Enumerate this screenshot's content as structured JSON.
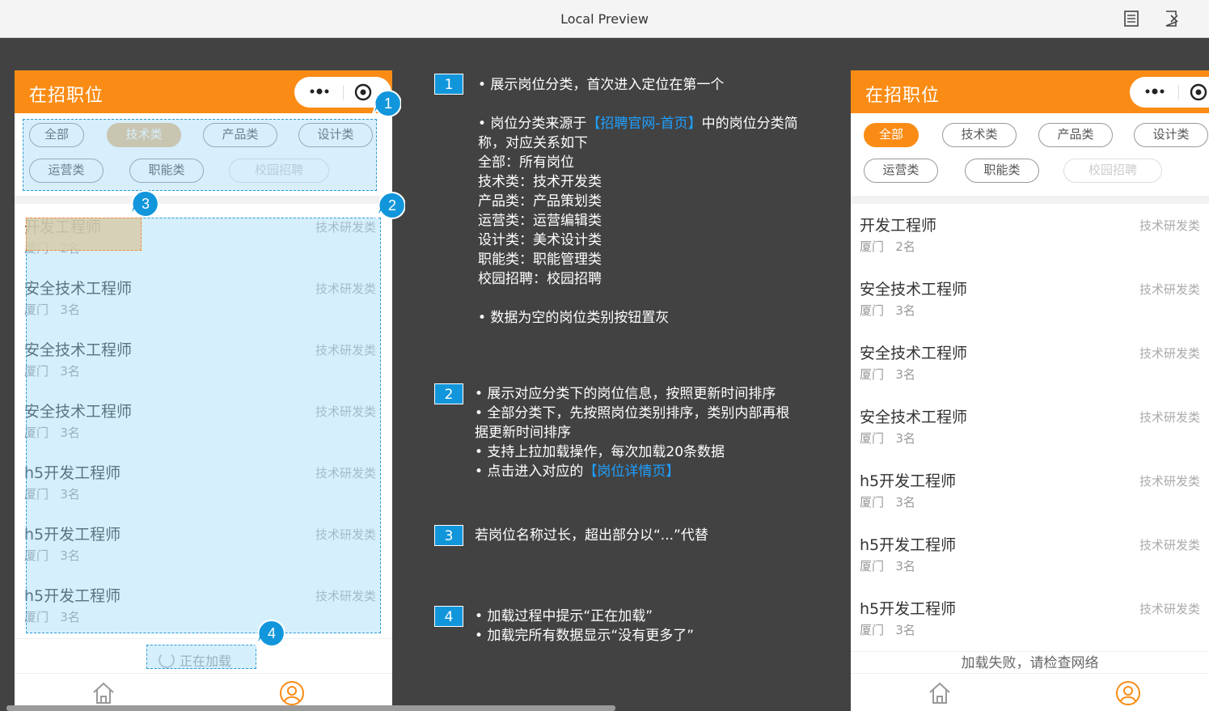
{
  "window": {
    "title": "Local Preview"
  },
  "phone": {
    "title": "在招职位",
    "tabs": [
      {
        "label": "全部",
        "state": "normal"
      },
      {
        "label": "技术类",
        "state": "active"
      },
      {
        "label": "产品类",
        "state": "normal"
      },
      {
        "label": "设计类",
        "state": "normal"
      },
      {
        "label": "运营类",
        "state": "normal"
      },
      {
        "label": "职能类",
        "state": "normal"
      },
      {
        "label": "校园招聘",
        "state": "disabled"
      }
    ],
    "jobs": [
      {
        "name": "开发工程师",
        "city": "厦门",
        "count": "2名",
        "category": "技术研发类"
      },
      {
        "name": "安全技术工程师",
        "city": "厦门",
        "count": "3名",
        "category": "技术研发类"
      },
      {
        "name": "安全技术工程师",
        "city": "厦门",
        "count": "3名",
        "category": "技术研发类"
      },
      {
        "name": "安全技术工程师",
        "city": "厦门",
        "count": "3名",
        "category": "技术研发类"
      },
      {
        "name": "h5开发工程师",
        "city": "厦门",
        "count": "3名",
        "category": "技术研发类"
      },
      {
        "name": "h5开发工程师",
        "city": "厦门",
        "count": "3名",
        "category": "技术研发类"
      },
      {
        "name": "h5开发工程师",
        "city": "厦门",
        "count": "3名",
        "category": "技术研发类"
      }
    ],
    "loading_text": "正在加载",
    "error_text": "加载失败，请检查网络"
  },
  "right_tabs_active": "全部",
  "badges": [
    "1",
    "2",
    "3",
    "4"
  ],
  "annotations": {
    "a1": {
      "num": "1",
      "line1": "• 展示岗位分类，首次进入定位在第一个",
      "line2_pre": "• 岗位分类来源于",
      "line2_link": "【招聘官网-首页】",
      "line2_post": "中的岗位分类简",
      "line3": "称，对应关系如下",
      "mapping": [
        "全部：所有岗位",
        "技术类：技术开发类",
        "产品类：产品策划类",
        "运营类：运营编辑类",
        "设计类：美术设计类",
        "职能类：职能管理类",
        "校园招聘：校园招聘"
      ],
      "line_last": "• 数据为空的岗位类别按钮置灰"
    },
    "a2": {
      "num": "2",
      "l1": "• 展示对应分类下的岗位信息，按照更新时间排序",
      "l2": "• 全部分类下，先按照岗位类别排序，类别内部再根",
      "l3": "据更新时间排序",
      "l4": "• 支持上拉加载操作，每次加载20条数据",
      "l5_pre": "• 点击进入对应的",
      "l5_link": "【岗位详情页】"
    },
    "a3": {
      "num": "3",
      "text": "若岗位名称过长，超出部分以“...”代替"
    },
    "a4": {
      "num": "4",
      "l1": "• 加载过程中提示“正在加载”",
      "l2": "• 加载完所有数据显示“没有更多了”"
    }
  },
  "colors": {
    "accent": "#fa8c16",
    "annotation_blue": "#1296db",
    "link": "#1e9fff"
  }
}
